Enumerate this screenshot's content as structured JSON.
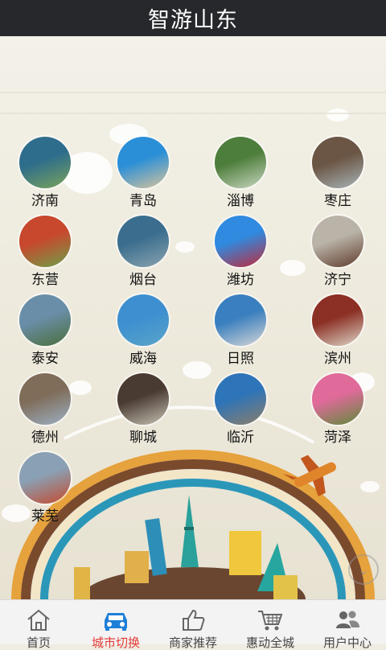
{
  "app": {
    "title": "智游山东"
  },
  "cities": [
    {
      "name": "济南",
      "col": 0,
      "row": 0,
      "c1": "#2e6d8c",
      "c2": "#7aa35a"
    },
    {
      "name": "青岛",
      "col": 1,
      "row": 0,
      "c1": "#2b8fd8",
      "c2": "#d8c49a"
    },
    {
      "name": "淄博",
      "col": 2,
      "row": 0,
      "c1": "#4e7e3c",
      "c2": "#c9d7c0"
    },
    {
      "name": "枣庄",
      "col": 3,
      "row": 0,
      "c1": "#6b5544",
      "c2": "#a7b5b8"
    },
    {
      "name": "东营",
      "col": 0,
      "row": 1,
      "c1": "#c8482d",
      "c2": "#6ea04a"
    },
    {
      "name": "烟台",
      "col": 1,
      "row": 1,
      "c1": "#3b6e8e",
      "c2": "#8aa3b0"
    },
    {
      "name": "潍坊",
      "col": 2,
      "row": 1,
      "c1": "#2f8ae0",
      "c2": "#c02a3a"
    },
    {
      "name": "济宁",
      "col": 3,
      "row": 1,
      "c1": "#b9b3a8",
      "c2": "#5e3b2a"
    },
    {
      "name": "泰安",
      "col": 0,
      "row": 2,
      "c1": "#6a8ea8",
      "c2": "#4b6e3a"
    },
    {
      "name": "威海",
      "col": 1,
      "row": 2,
      "c1": "#3d8fd0",
      "c2": "#5aa4c8"
    },
    {
      "name": "日照",
      "col": 2,
      "row": 2,
      "c1": "#3a7fbf",
      "c2": "#d6d6d6"
    },
    {
      "name": "滨州",
      "col": 3,
      "row": 2,
      "c1": "#8c2f24",
      "c2": "#ddd7c8"
    },
    {
      "name": "德州",
      "col": 0,
      "row": 3,
      "c1": "#7f6d5a",
      "c2": "#9db0c4"
    },
    {
      "name": "聊城",
      "col": 1,
      "row": 3,
      "c1": "#4a3b32",
      "c2": "#c7c3b5"
    },
    {
      "name": "临沂",
      "col": 2,
      "row": 3,
      "c1": "#2e74b8",
      "c2": "#8b7e6a"
    },
    {
      "name": "菏泽",
      "col": 3,
      "row": 3,
      "c1": "#e06a9a",
      "c2": "#5e8a3a"
    },
    {
      "name": "莱芜",
      "col": 0,
      "row": 4,
      "c1": "#8aa0b4",
      "c2": "#c44a2e"
    }
  ],
  "tabs": [
    {
      "label": "首页",
      "icon": "home-icon",
      "active": false
    },
    {
      "label": "城市切换",
      "icon": "car-icon",
      "active": true
    },
    {
      "label": "商家推荐",
      "icon": "thumbs-up-icon",
      "active": false
    },
    {
      "label": "惠动全城",
      "icon": "cart-icon",
      "active": false
    },
    {
      "label": "用户中心",
      "icon": "users-icon",
      "active": false
    }
  ],
  "colors": {
    "titlebar": "#26282b",
    "active_tab": "#e53935",
    "active_icon": "#1e7fd8"
  }
}
